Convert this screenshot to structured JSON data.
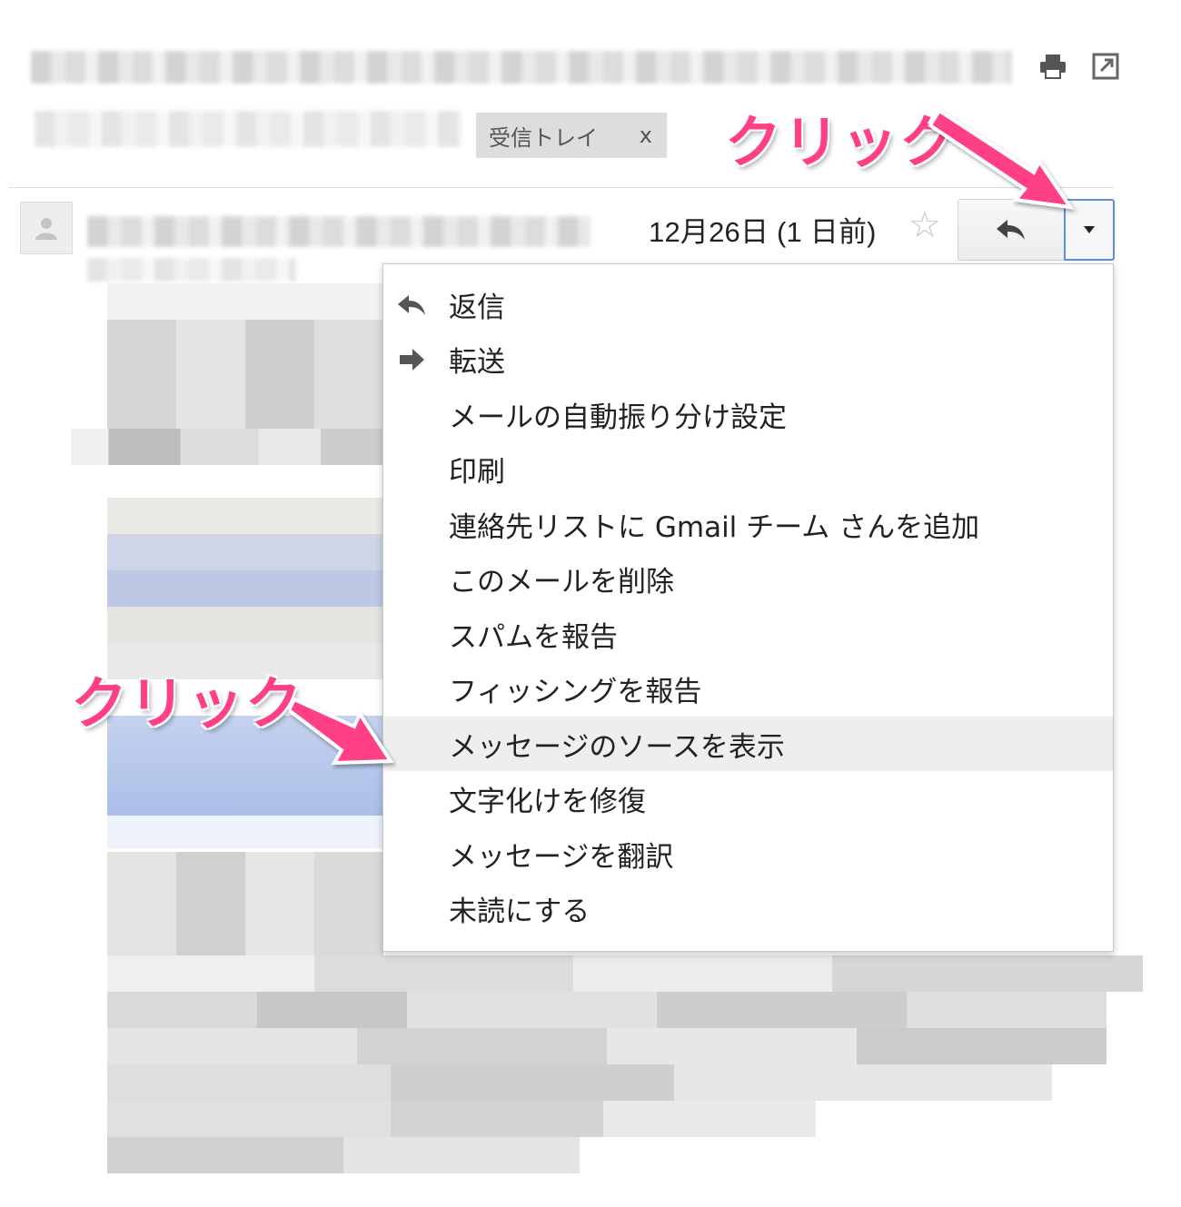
{
  "labels": {
    "inbox_chip": "受信トレイ",
    "chip_remove": "x"
  },
  "message": {
    "date": "12月26日 (1 日前)"
  },
  "icons": {
    "print": "print-icon",
    "popout": "popout-icon",
    "star": "star-icon",
    "reply": "reply-icon",
    "more": "chevron-down-icon",
    "avatar": "person-icon",
    "menu_reply": "reply-icon",
    "menu_forward": "forward-icon"
  },
  "menu": {
    "items": [
      {
        "label": "返信"
      },
      {
        "label": "転送"
      },
      {
        "label": "メールの自動振り分け設定"
      },
      {
        "label": "印刷"
      },
      {
        "label": "連絡先リストに Gmail チーム さんを追加"
      },
      {
        "label": "このメールを削除"
      },
      {
        "label": "スパムを報告"
      },
      {
        "label": "フィッシングを報告"
      },
      {
        "label": "メッセージのソースを表示"
      },
      {
        "label": "文字化けを修復"
      },
      {
        "label": "メッセージを翻訳"
      },
      {
        "label": "未読にする"
      }
    ],
    "highlighted_index": 8
  },
  "annotations": {
    "top_callout": "クリック",
    "left_callout": "クリック"
  },
  "colors": {
    "callout": "#ff3f86",
    "highlight": "#eeeeee",
    "focus_border": "#5b8fe6"
  }
}
